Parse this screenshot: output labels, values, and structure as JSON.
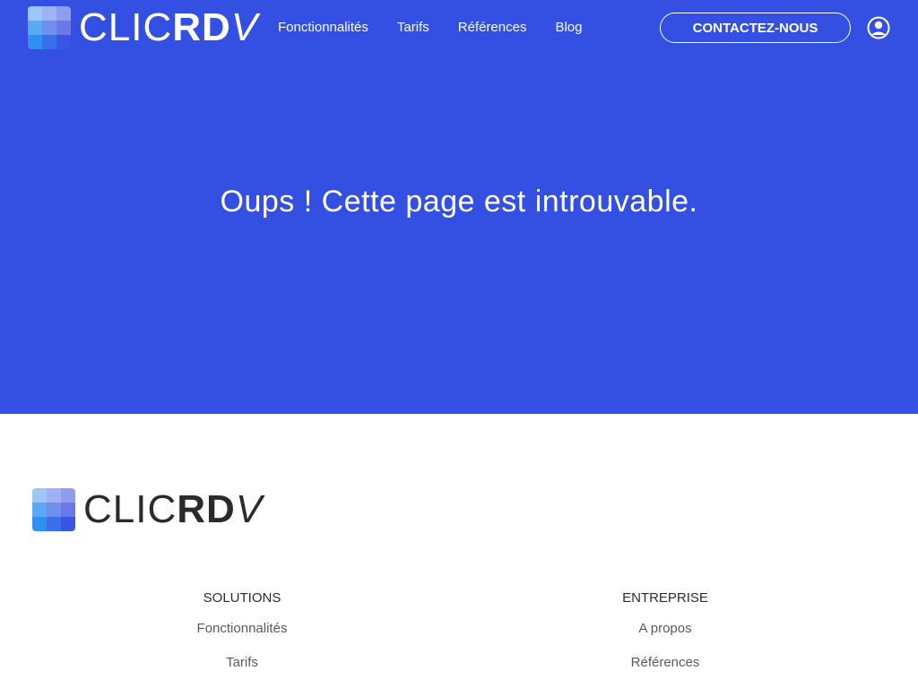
{
  "brand": {
    "light": "CLIC",
    "bold": "RD",
    "check": "V",
    "mark_colors": [
      "#9ec7f7",
      "#9fb3f4",
      "#8f9df0",
      "#5aa9f5",
      "#6f8ff0",
      "#6b78ea",
      "#2f8ff2",
      "#3a6fec",
      "#3a55e3"
    ]
  },
  "header": {
    "nav": [
      {
        "label": "Fonctionnalités"
      },
      {
        "label": "Tarifs"
      },
      {
        "label": "Références"
      },
      {
        "label": "Blog"
      }
    ],
    "contact_label": "CONTACTEZ-NOUS",
    "user_icon": "user-icon"
  },
  "hero": {
    "message": "Oups ! Cette page est introuvable.",
    "background": "#3350e3"
  },
  "footer": {
    "solutions": {
      "title": "SOLUTIONS",
      "links": [
        {
          "label": "Fonctionnalités"
        },
        {
          "label": "Tarifs"
        }
      ]
    },
    "entreprise": {
      "title": "ENTREPRISE",
      "links": [
        {
          "label": "A propos"
        },
        {
          "label": "Références"
        }
      ]
    }
  }
}
